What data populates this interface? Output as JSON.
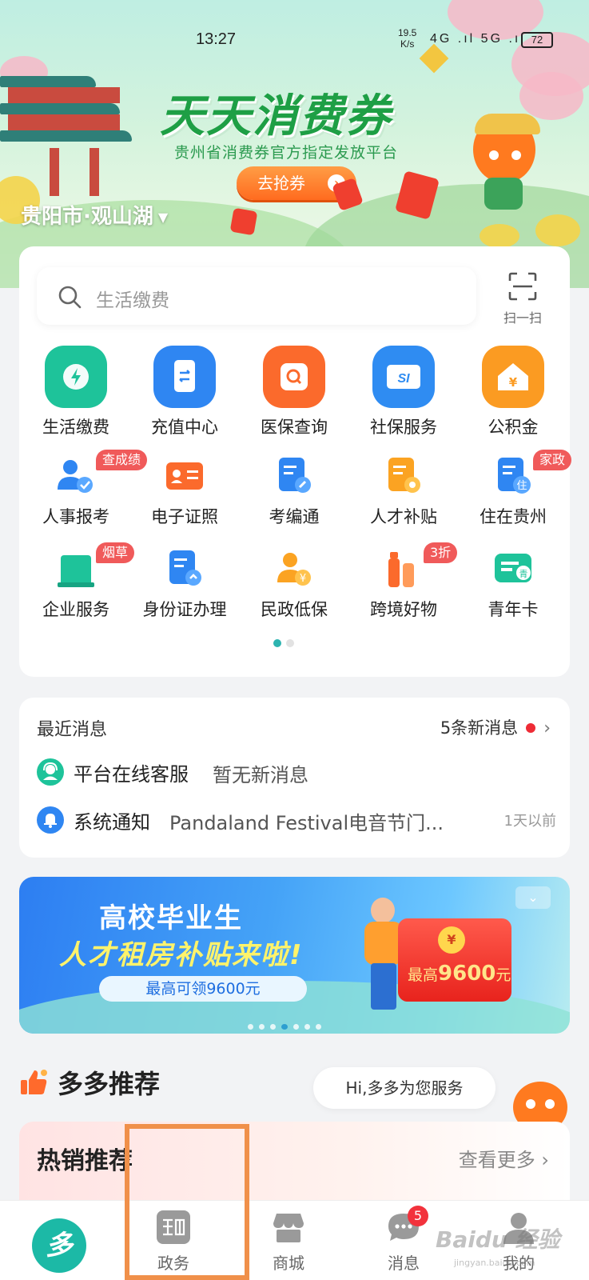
{
  "status_bar": {
    "time": "13:27",
    "net_speed_value": "19.5",
    "net_speed_unit": "K/s",
    "signal": "4G .ıl 5G .ıl",
    "battery": "72"
  },
  "hero": {
    "title": "天天消费券",
    "subtitle": "贵州省消费券官方指定发放平台",
    "button_label": "去抢券",
    "button_arrow": "›",
    "city": "贵阳市·观山湖",
    "city_caret": "▼",
    "mascot_badge": "多"
  },
  "search": {
    "placeholder": "生活缴费",
    "scan_label": "扫一扫"
  },
  "services": {
    "row1": [
      {
        "label": "生活缴费",
        "icon": "bolt-icon",
        "color": "#1ec39a",
        "glyph": "⚡"
      },
      {
        "label": "充值中心",
        "icon": "phone-recharge-icon",
        "color": "#2f86f2",
        "glyph": "⇌"
      },
      {
        "label": "医保查询",
        "icon": "medical-search-icon",
        "color": "#fb6a2c",
        "glyph": "Q"
      },
      {
        "label": "社保服务",
        "icon": "social-security-icon",
        "color": "#2f8cf2",
        "glyph": "SI"
      },
      {
        "label": "公积金",
        "icon": "housing-fund-icon",
        "color": "#fb9b22",
        "glyph": "¥"
      }
    ],
    "row2": [
      {
        "label": "人事报考",
        "icon": "personnel-exam-icon",
        "badge": "查成绩"
      },
      {
        "label": "电子证照",
        "icon": "e-license-icon",
        "badge": ""
      },
      {
        "label": "考编通",
        "icon": "civil-exam-icon",
        "badge": ""
      },
      {
        "label": "人才补贴",
        "icon": "talent-subsidy-icon",
        "badge": ""
      },
      {
        "label": "住在贵州",
        "icon": "live-guizhou-icon",
        "badge": "家政"
      }
    ],
    "row3": [
      {
        "label": "企业服务",
        "icon": "enterprise-icon",
        "badge": "烟草"
      },
      {
        "label": "身份证办理",
        "icon": "id-card-icon",
        "badge": ""
      },
      {
        "label": "民政低保",
        "icon": "civil-welfare-icon",
        "badge": ""
      },
      {
        "label": "跨境好物",
        "icon": "cross-border-icon",
        "badge": "3折"
      },
      {
        "label": "青年卡",
        "icon": "youth-card-icon",
        "badge": ""
      }
    ],
    "page_dots": 2,
    "active_page": 1,
    "small_glyphs": {
      "live-guizhou-icon": "住",
      "civil-welfare-icon": "¥",
      "youth-card-icon": "青"
    }
  },
  "messages": {
    "title": "最近消息",
    "new_count": "5条新消息",
    "chevron": "›",
    "items": [
      {
        "name": "平台在线客服",
        "text": "暂无新消息",
        "time": "",
        "icon": "customer-service-icon",
        "color": "#1ec39a"
      },
      {
        "name": "系统通知",
        "text": "Pandaland Festival电音节门...",
        "time": "1天以前",
        "icon": "bell-icon",
        "color": "#2f86f2"
      }
    ]
  },
  "promo": {
    "line1": "高校毕业生",
    "line2": "人才租房补贴来啦!",
    "line3": "最高可领9600元",
    "envelope_prefix": "最高",
    "envelope_amount": "9600",
    "envelope_suffix": "元",
    "envelope_coin": "¥",
    "collapse_glyph": "⌄",
    "dots": 7,
    "active_dot": 4
  },
  "recommend": {
    "title": "多多推荐",
    "chat_bubble": "Hi,多多为您服务",
    "hot_title": "热销推荐",
    "hot_more": "查看更多",
    "hot_more_chevron": "›"
  },
  "bottom_nav": {
    "home_glyph": "多",
    "items": [
      {
        "label": "政务",
        "icon": "government-icon"
      },
      {
        "label": "商城",
        "icon": "mall-icon"
      },
      {
        "label": "消息",
        "icon": "message-icon",
        "badge": "5"
      },
      {
        "label": "我的",
        "icon": "profile-icon"
      }
    ]
  },
  "watermark": {
    "text": "Baidu 经验",
    "sub": "jingyan.baidu.com"
  }
}
